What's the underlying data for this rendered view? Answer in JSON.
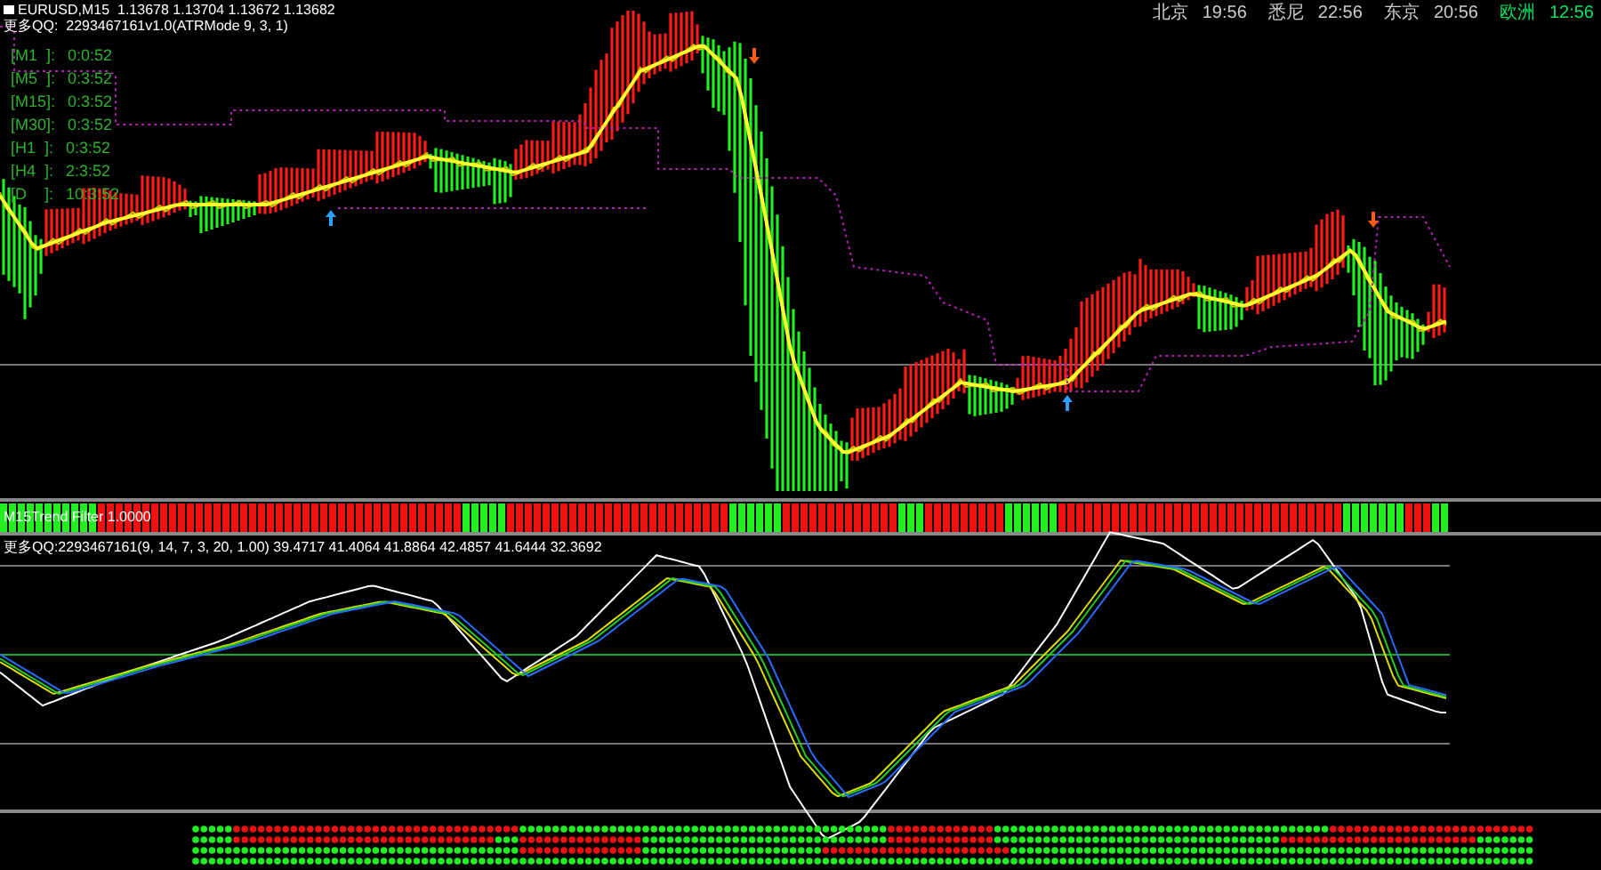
{
  "symbol_header": "EURUSD,M15  1.13678 1.13704 1.13672 1.13682",
  "indicator_label": "更多QQ:  2293467161v1.0(ATRMode 9, 3, 1)",
  "timers": [
    {
      "label": "[M1  ]:",
      "value": "0:0:52"
    },
    {
      "label": "[M5  ]:",
      "value": "0:3:52"
    },
    {
      "label": "[M15]:",
      "value": "0:3:52"
    },
    {
      "label": "[M30]:",
      "value": "0:3:52"
    },
    {
      "label": "[H1  ]:",
      "value": "0:3:52"
    },
    {
      "label": "[H4  ]:",
      "value": "2:3:52"
    },
    {
      "label": "[D    ]:",
      "value": "10:3:52"
    }
  ],
  "clocks": [
    {
      "city": "北京",
      "time": "19:56",
      "highlighted": false
    },
    {
      "city": "悉尼",
      "time": "22:56",
      "highlighted": false
    },
    {
      "city": "东京",
      "time": "20:56",
      "highlighted": false
    },
    {
      "city": "欧洲",
      "time": "12:56",
      "highlighted": true
    }
  ],
  "trend_strip": {
    "label": "M15Trend Filter 1.0000"
  },
  "oscillator": {
    "label": "更多QQ:2293467161(9, 14, 7, 3, 20, 1.00) 39.4717 41.4064 41.8864 42.4857 41.6444 32.3692"
  }
}
